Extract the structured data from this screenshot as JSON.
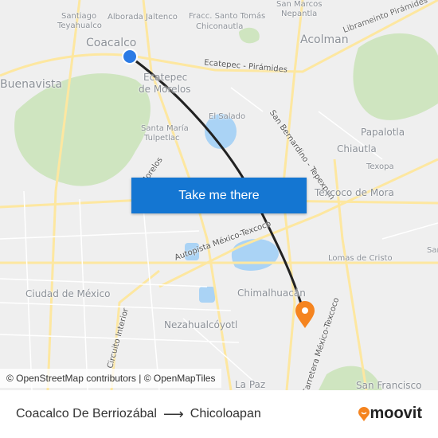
{
  "map": {
    "labels": [
      "Santiago",
      "Teyahualco",
      "Alborada Jaltenco",
      "Fracc. Santo Tomás",
      "Chiconautla",
      "San Marcos",
      "Nepantla",
      "Coacalco",
      "Acolman",
      "Librameinto Pirámides",
      "Buenavista",
      "Ecatepec",
      "de Morelos",
      "Ecatepec - Pirámides",
      "San Bernardino - Tepexpan",
      "El Salado",
      "Santa María",
      "Tulpetlac",
      "Papalotla",
      "Chiautla",
      "Texopa",
      "Morelos",
      "Texcoco de Mora",
      "Autopista México-Texcoco",
      "Lomas de Cristo",
      "Ciudad de México",
      "Chimalhuacán",
      "Circuito Interior",
      "Nezahualcóyotl",
      "Carretera México-Texcoco",
      "La Paz",
      "San Francisco",
      "San"
    ],
    "colors": {
      "origin": "#2c7be5",
      "destination": "#f5841f",
      "route": "#222222",
      "water": "#aad3f5",
      "park": "#cfe5c0",
      "road": "#fde7a0"
    }
  },
  "cta": {
    "label": "Take me there"
  },
  "attribution": "© OpenStreetMap contributors | © OpenMapTiles",
  "footer": {
    "origin": "Coacalco De Berriozábal",
    "arrow": "⟶",
    "destination": "Chicoloapan",
    "brand": "moovit"
  }
}
